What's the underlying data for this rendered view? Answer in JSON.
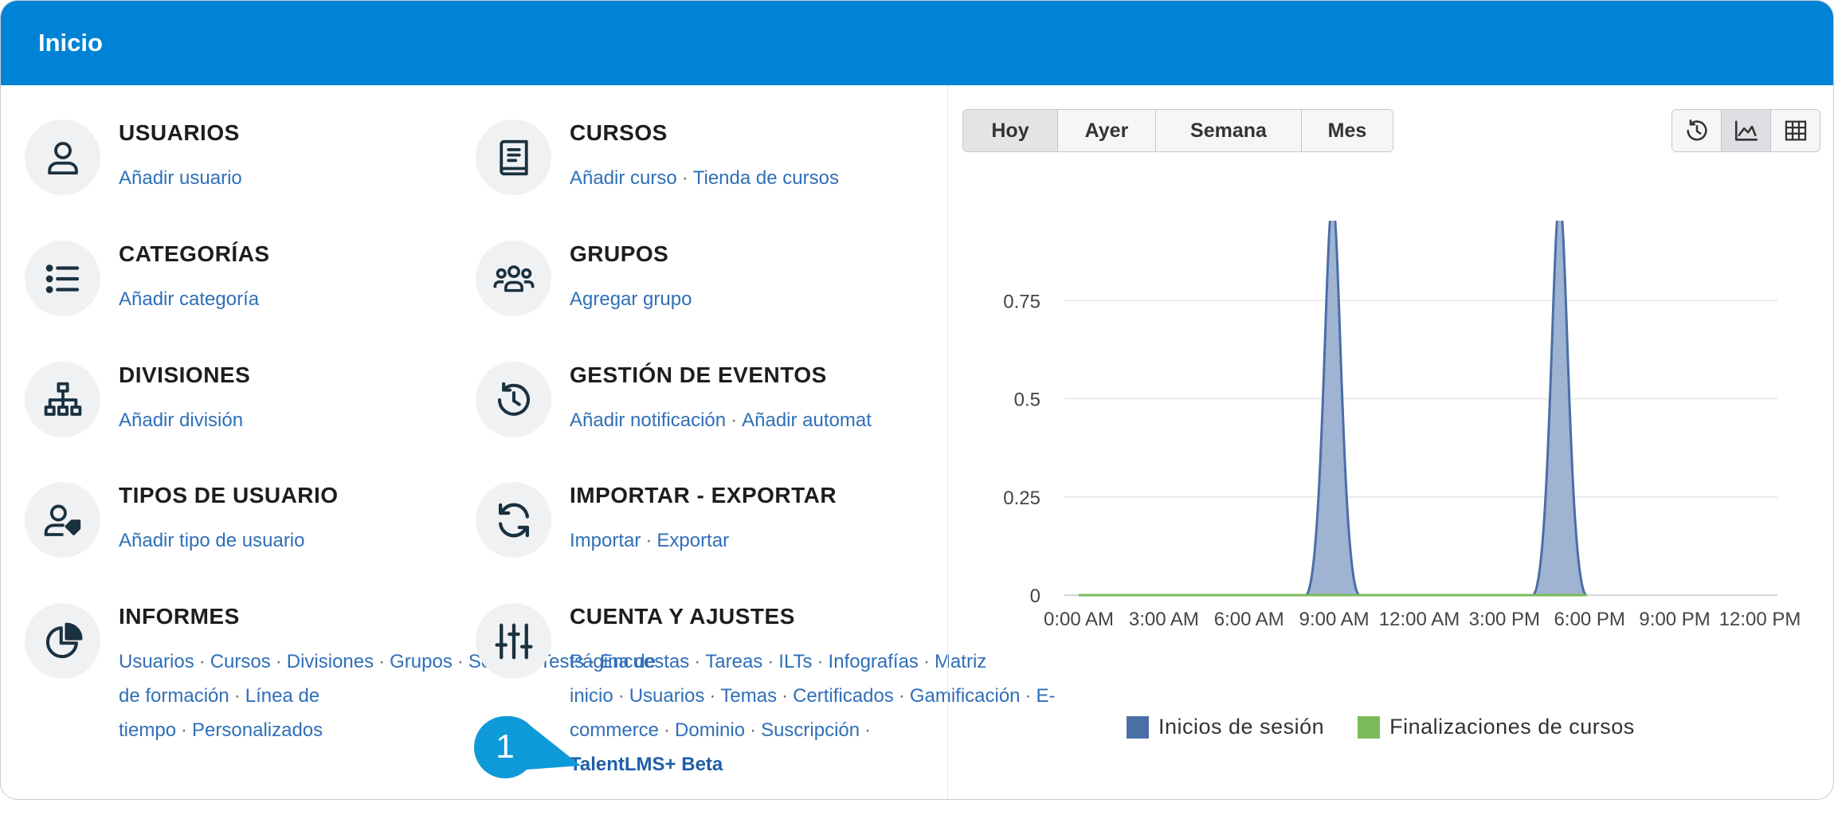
{
  "header": {
    "title": "Inicio"
  },
  "tiles": {
    "usuarios": {
      "title": "USUARIOS",
      "links": [
        "Añadir usuario"
      ]
    },
    "categorias": {
      "title": "CATEGORÍAS",
      "links": [
        "Añadir categoría"
      ]
    },
    "divisiones": {
      "title": "DIVISIONES",
      "links": [
        "Añadir división"
      ]
    },
    "tipos": {
      "title": "TIPOS DE USUARIO",
      "links": [
        "Añadir tipo de usuario"
      ]
    },
    "informes": {
      "title": "INFORMES",
      "links": [
        "Usuarios",
        "Cursos",
        "Divisiones",
        "Grupos",
        "Scorm",
        "Tests",
        "Encuestas",
        "Tareas",
        "ILTs",
        "Infografías",
        "Matriz de formación",
        "Línea de tiempo",
        "Personalizados"
      ]
    },
    "cursos": {
      "title": "CURSOS",
      "links": [
        "Añadir curso",
        "Tienda de cursos"
      ]
    },
    "grupos": {
      "title": "GRUPOS",
      "links": [
        "Agregar grupo"
      ]
    },
    "eventos": {
      "title": "GESTIÓN DE EVENTOS",
      "links": [
        "Añadir notificación",
        "Añadir automat"
      ]
    },
    "importar": {
      "title": "IMPORTAR - EXPORTAR",
      "links": [
        "Importar",
        "Exportar"
      ]
    },
    "cuenta": {
      "title": "CUENTA Y AJUSTES",
      "links": [
        "Página de inicio",
        "Usuarios",
        "Temas",
        "Certificados",
        "Gamificación",
        "E-commerce",
        "Dominio",
        "Suscripción"
      ],
      "highlight_link": "TalentLMS+ Beta"
    }
  },
  "callout": {
    "number": "1",
    "color": "#0e9ad8"
  },
  "period_tabs": {
    "items": [
      "Hoy",
      "Ayer",
      "Semana",
      "Mes"
    ],
    "active": "Hoy"
  },
  "view_buttons": [
    {
      "icon": "history-icon"
    },
    {
      "icon": "area-chart-icon",
      "active": true
    },
    {
      "icon": "table-grid-icon"
    }
  ],
  "colors": {
    "header": "#0083d6",
    "link": "#2f6fb8",
    "icon": "#1a3140"
  },
  "chart_data": {
    "type": "area",
    "x": [
      "0:00 AM",
      "3:00 AM",
      "6:00 AM",
      "9:00 AM",
      "12:00 AM",
      "3:00 PM",
      "6:00 PM",
      "9:00 PM",
      "12:00 PM"
    ],
    "ylim": [
      0,
      1
    ],
    "yticks": [
      "0",
      "0.25",
      "0.5",
      "0.75",
      "1"
    ],
    "grid": true,
    "legend_position": "bottom",
    "series": [
      {
        "name": "Inicios de sesión",
        "color": "#4a6fa5",
        "peaks_at_hours": [
          9,
          17
        ],
        "values_at_peaks": [
          1,
          1
        ]
      },
      {
        "name": "Finalizaciones de cursos",
        "color": "#7cba59",
        "value": 0
      }
    ]
  }
}
